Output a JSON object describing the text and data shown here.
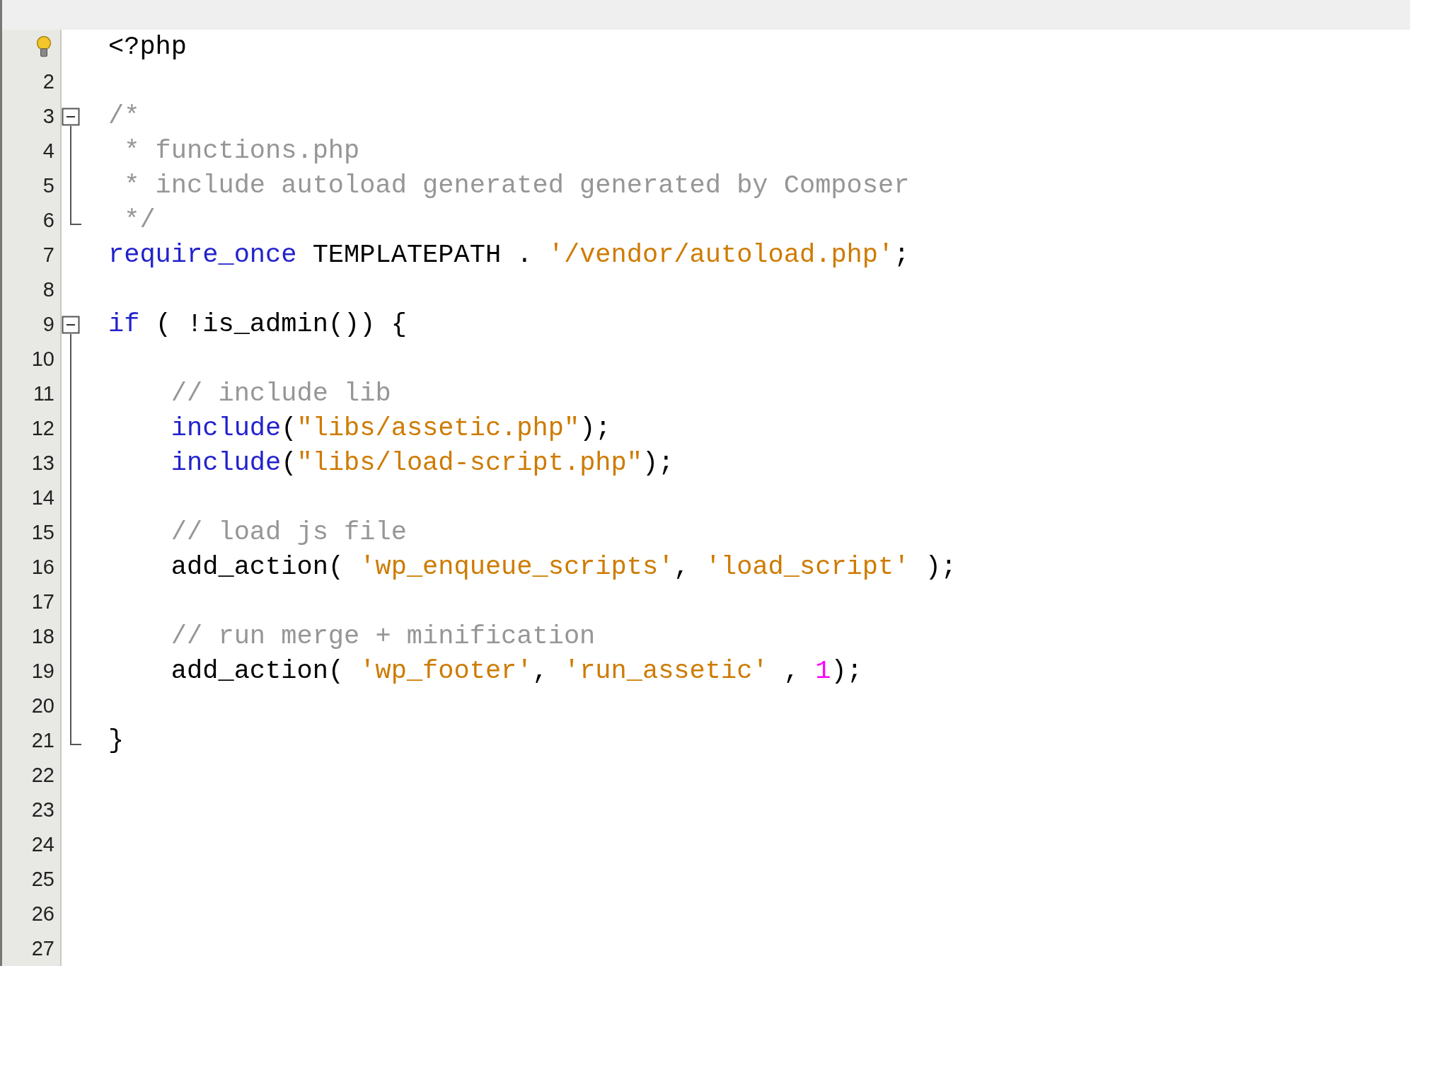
{
  "editor": {
    "lines": [
      {
        "hint": true,
        "kind": "plain",
        "tokens": [
          {
            "kind": "plain",
            "text": "<?php"
          }
        ]
      },
      {
        "number": "2",
        "kind": "plain"
      },
      {
        "number": "3",
        "kind": "fold-start",
        "tokens": [
          {
            "kind": "comment",
            "text": "/*"
          }
        ]
      },
      {
        "number": "4",
        "kind": "fold-body",
        "tokens": [
          {
            "kind": "comment",
            "text": " * functions.php"
          }
        ]
      },
      {
        "number": "5",
        "kind": "fold-body",
        "tokens": [
          {
            "kind": "comment",
            "text": " * include autoload generated generated by Composer"
          }
        ]
      },
      {
        "number": "6",
        "kind": "fold-end",
        "tokens": [
          {
            "kind": "comment",
            "text": " */"
          }
        ]
      },
      {
        "number": "7",
        "kind": "plain",
        "tokens": [
          {
            "kind": "keyword",
            "text": "require_once"
          },
          {
            "kind": "plain",
            "text": " TEMPLATEPATH . "
          },
          {
            "kind": "string",
            "text": "'/vendor/autoload.php'"
          },
          {
            "kind": "plain",
            "text": ";"
          }
        ]
      },
      {
        "number": "8",
        "kind": "plain"
      },
      {
        "number": "9",
        "kind": "fold-start",
        "tokens": [
          {
            "kind": "keyword",
            "text": "if"
          },
          {
            "kind": "plain",
            "text": " ( !is_admin()) {"
          }
        ]
      },
      {
        "number": "10",
        "kind": "fold-body"
      },
      {
        "number": "11",
        "kind": "fold-body",
        "tokens": [
          {
            "kind": "comment",
            "text": "    // include lib"
          }
        ]
      },
      {
        "number": "12",
        "kind": "fold-body",
        "tokens": [
          {
            "kind": "keyword",
            "text": "    include"
          },
          {
            "kind": "plain",
            "text": "("
          },
          {
            "kind": "string",
            "text": "\"libs/assetic.php\""
          },
          {
            "kind": "plain",
            "text": ");"
          }
        ]
      },
      {
        "number": "13",
        "kind": "fold-body",
        "tokens": [
          {
            "kind": "keyword",
            "text": "    include"
          },
          {
            "kind": "plain",
            "text": "("
          },
          {
            "kind": "string",
            "text": "\"libs/load-script.php\""
          },
          {
            "kind": "plain",
            "text": ");"
          }
        ]
      },
      {
        "number": "14",
        "kind": "fold-body"
      },
      {
        "number": "15",
        "kind": "fold-body",
        "tokens": [
          {
            "kind": "comment",
            "text": "    // load js file"
          }
        ]
      },
      {
        "number": "16",
        "kind": "fold-body",
        "tokens": [
          {
            "kind": "plain",
            "text": "    add_action( "
          },
          {
            "kind": "string",
            "text": "'wp_enqueue_scripts'"
          },
          {
            "kind": "plain",
            "text": ", "
          },
          {
            "kind": "string",
            "text": "'load_script'"
          },
          {
            "kind": "plain",
            "text": " );"
          }
        ]
      },
      {
        "number": "17",
        "kind": "fold-body"
      },
      {
        "number": "18",
        "kind": "fold-body",
        "tokens": [
          {
            "kind": "comment",
            "text": "    // run merge + minification"
          }
        ]
      },
      {
        "number": "19",
        "kind": "fold-body",
        "tokens": [
          {
            "kind": "plain",
            "text": "    add_action( "
          },
          {
            "kind": "string",
            "text": "'wp_footer'"
          },
          {
            "kind": "plain",
            "text": ", "
          },
          {
            "kind": "string",
            "text": "'run_assetic'"
          },
          {
            "kind": "plain",
            "text": " , "
          },
          {
            "kind": "number",
            "text": "1"
          },
          {
            "kind": "plain",
            "text": ");"
          }
        ]
      },
      {
        "number": "20",
        "kind": "fold-body"
      },
      {
        "number": "21",
        "kind": "fold-end",
        "tokens": [
          {
            "kind": "plain",
            "text": "}"
          }
        ]
      },
      {
        "number": "22",
        "kind": "plain"
      },
      {
        "number": "23",
        "kind": "plain"
      },
      {
        "number": "24",
        "kind": "plain"
      },
      {
        "number": "25",
        "kind": "plain"
      },
      {
        "number": "26",
        "kind": "plain"
      },
      {
        "number": "27",
        "kind": "plain"
      }
    ]
  }
}
